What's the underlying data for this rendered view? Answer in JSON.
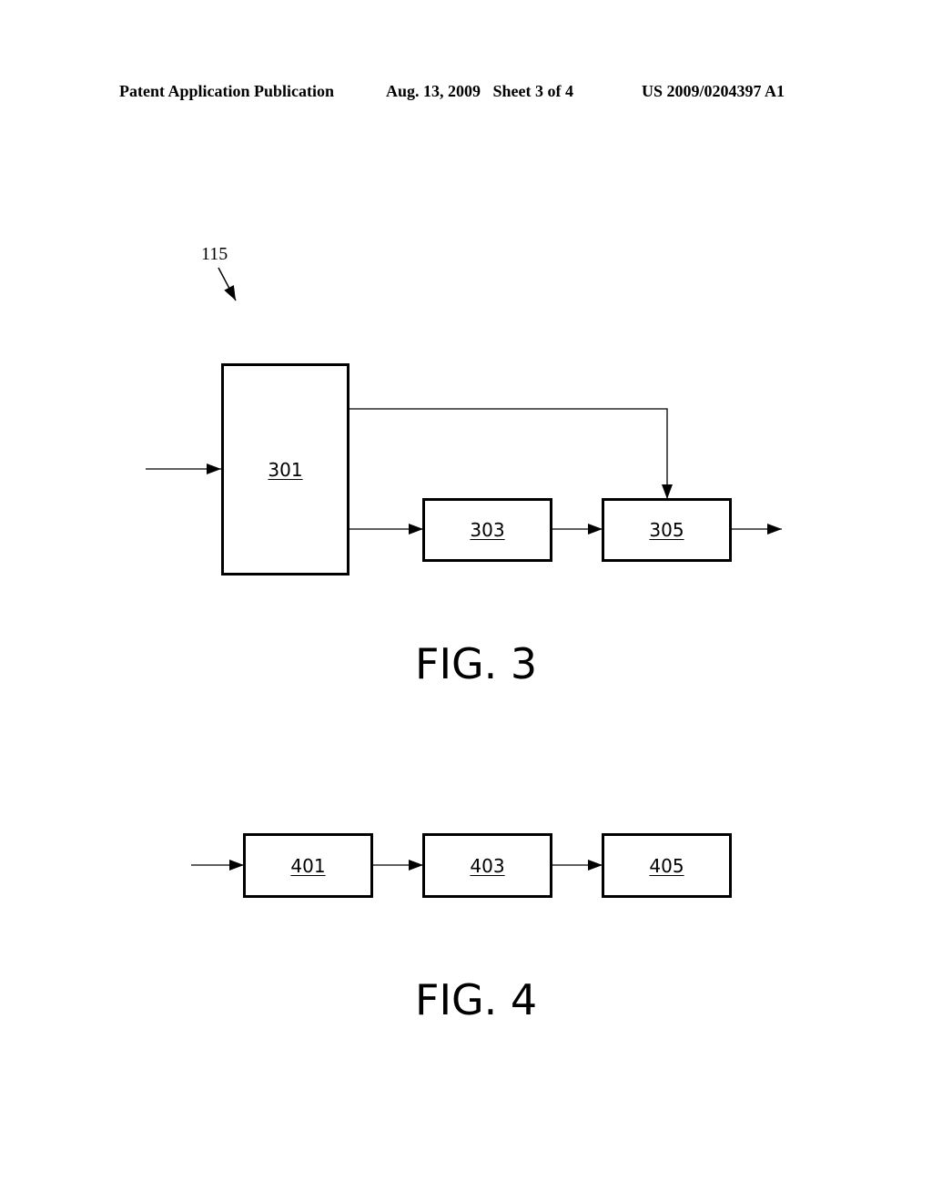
{
  "header": {
    "publication": "Patent Application Publication",
    "date_sheet": "Aug. 13, 2009   Sheet 3 of 4",
    "pub_number": "US 2009/0204397 A1"
  },
  "fig3": {
    "reference": "115",
    "blocks": {
      "b301": "301",
      "b303": "303",
      "b305": "305"
    },
    "caption": "FIG. 3"
  },
  "fig4": {
    "blocks": {
      "b401": "401",
      "b403": "403",
      "b405": "405"
    },
    "caption": "FIG. 4"
  }
}
